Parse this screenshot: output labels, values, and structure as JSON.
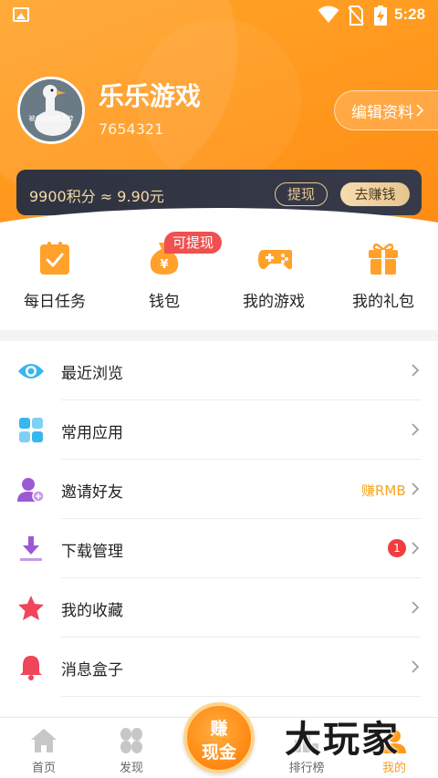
{
  "status_bar": {
    "time": "5:28"
  },
  "profile": {
    "name": "乐乐游戏",
    "user_id": "7654321",
    "avatar_caption": "被命运扼住了脖",
    "edit_label": "编辑资料"
  },
  "points": {
    "summary": "9900积分 ≈ 9.90元",
    "withdraw_label": "提现",
    "earn_label": "去赚钱"
  },
  "quick_actions": [
    {
      "label": "每日任务",
      "icon": "clipboard-check-icon"
    },
    {
      "label": "钱包",
      "icon": "money-bag-icon",
      "badge": "可提现"
    },
    {
      "label": "我的游戏",
      "icon": "gamepad-icon"
    },
    {
      "label": "我的礼包",
      "icon": "gift-icon"
    }
  ],
  "menu": [
    {
      "label": "最近浏览",
      "icon": "eye-icon"
    },
    {
      "label": "常用应用",
      "icon": "apps-grid-icon"
    },
    {
      "label": "邀请好友",
      "icon": "add-user-icon",
      "hint": "赚RMB"
    },
    {
      "label": "下载管理",
      "icon": "download-icon",
      "count": "1"
    },
    {
      "label": "我的收藏",
      "icon": "star-icon"
    },
    {
      "label": "消息盒子",
      "icon": "bell-icon"
    }
  ],
  "tabbar": {
    "tabs": [
      {
        "label": "首页",
        "icon": "home-icon"
      },
      {
        "label": "发现",
        "icon": "discover-icon"
      },
      {
        "label": "排行榜",
        "icon": "ranking-icon"
      },
      {
        "label": "我的",
        "icon": "profile-icon",
        "active": true
      }
    ],
    "center_button": {
      "line1": "赚",
      "line2": "现金"
    }
  },
  "watermark": "大玩家",
  "colors": {
    "brand_orange": "#ff9a1f",
    "card_dark": "#333744",
    "accent_gold": "#e9c893",
    "badge_red": "#f05050",
    "hint_orange": "#f5a623"
  }
}
